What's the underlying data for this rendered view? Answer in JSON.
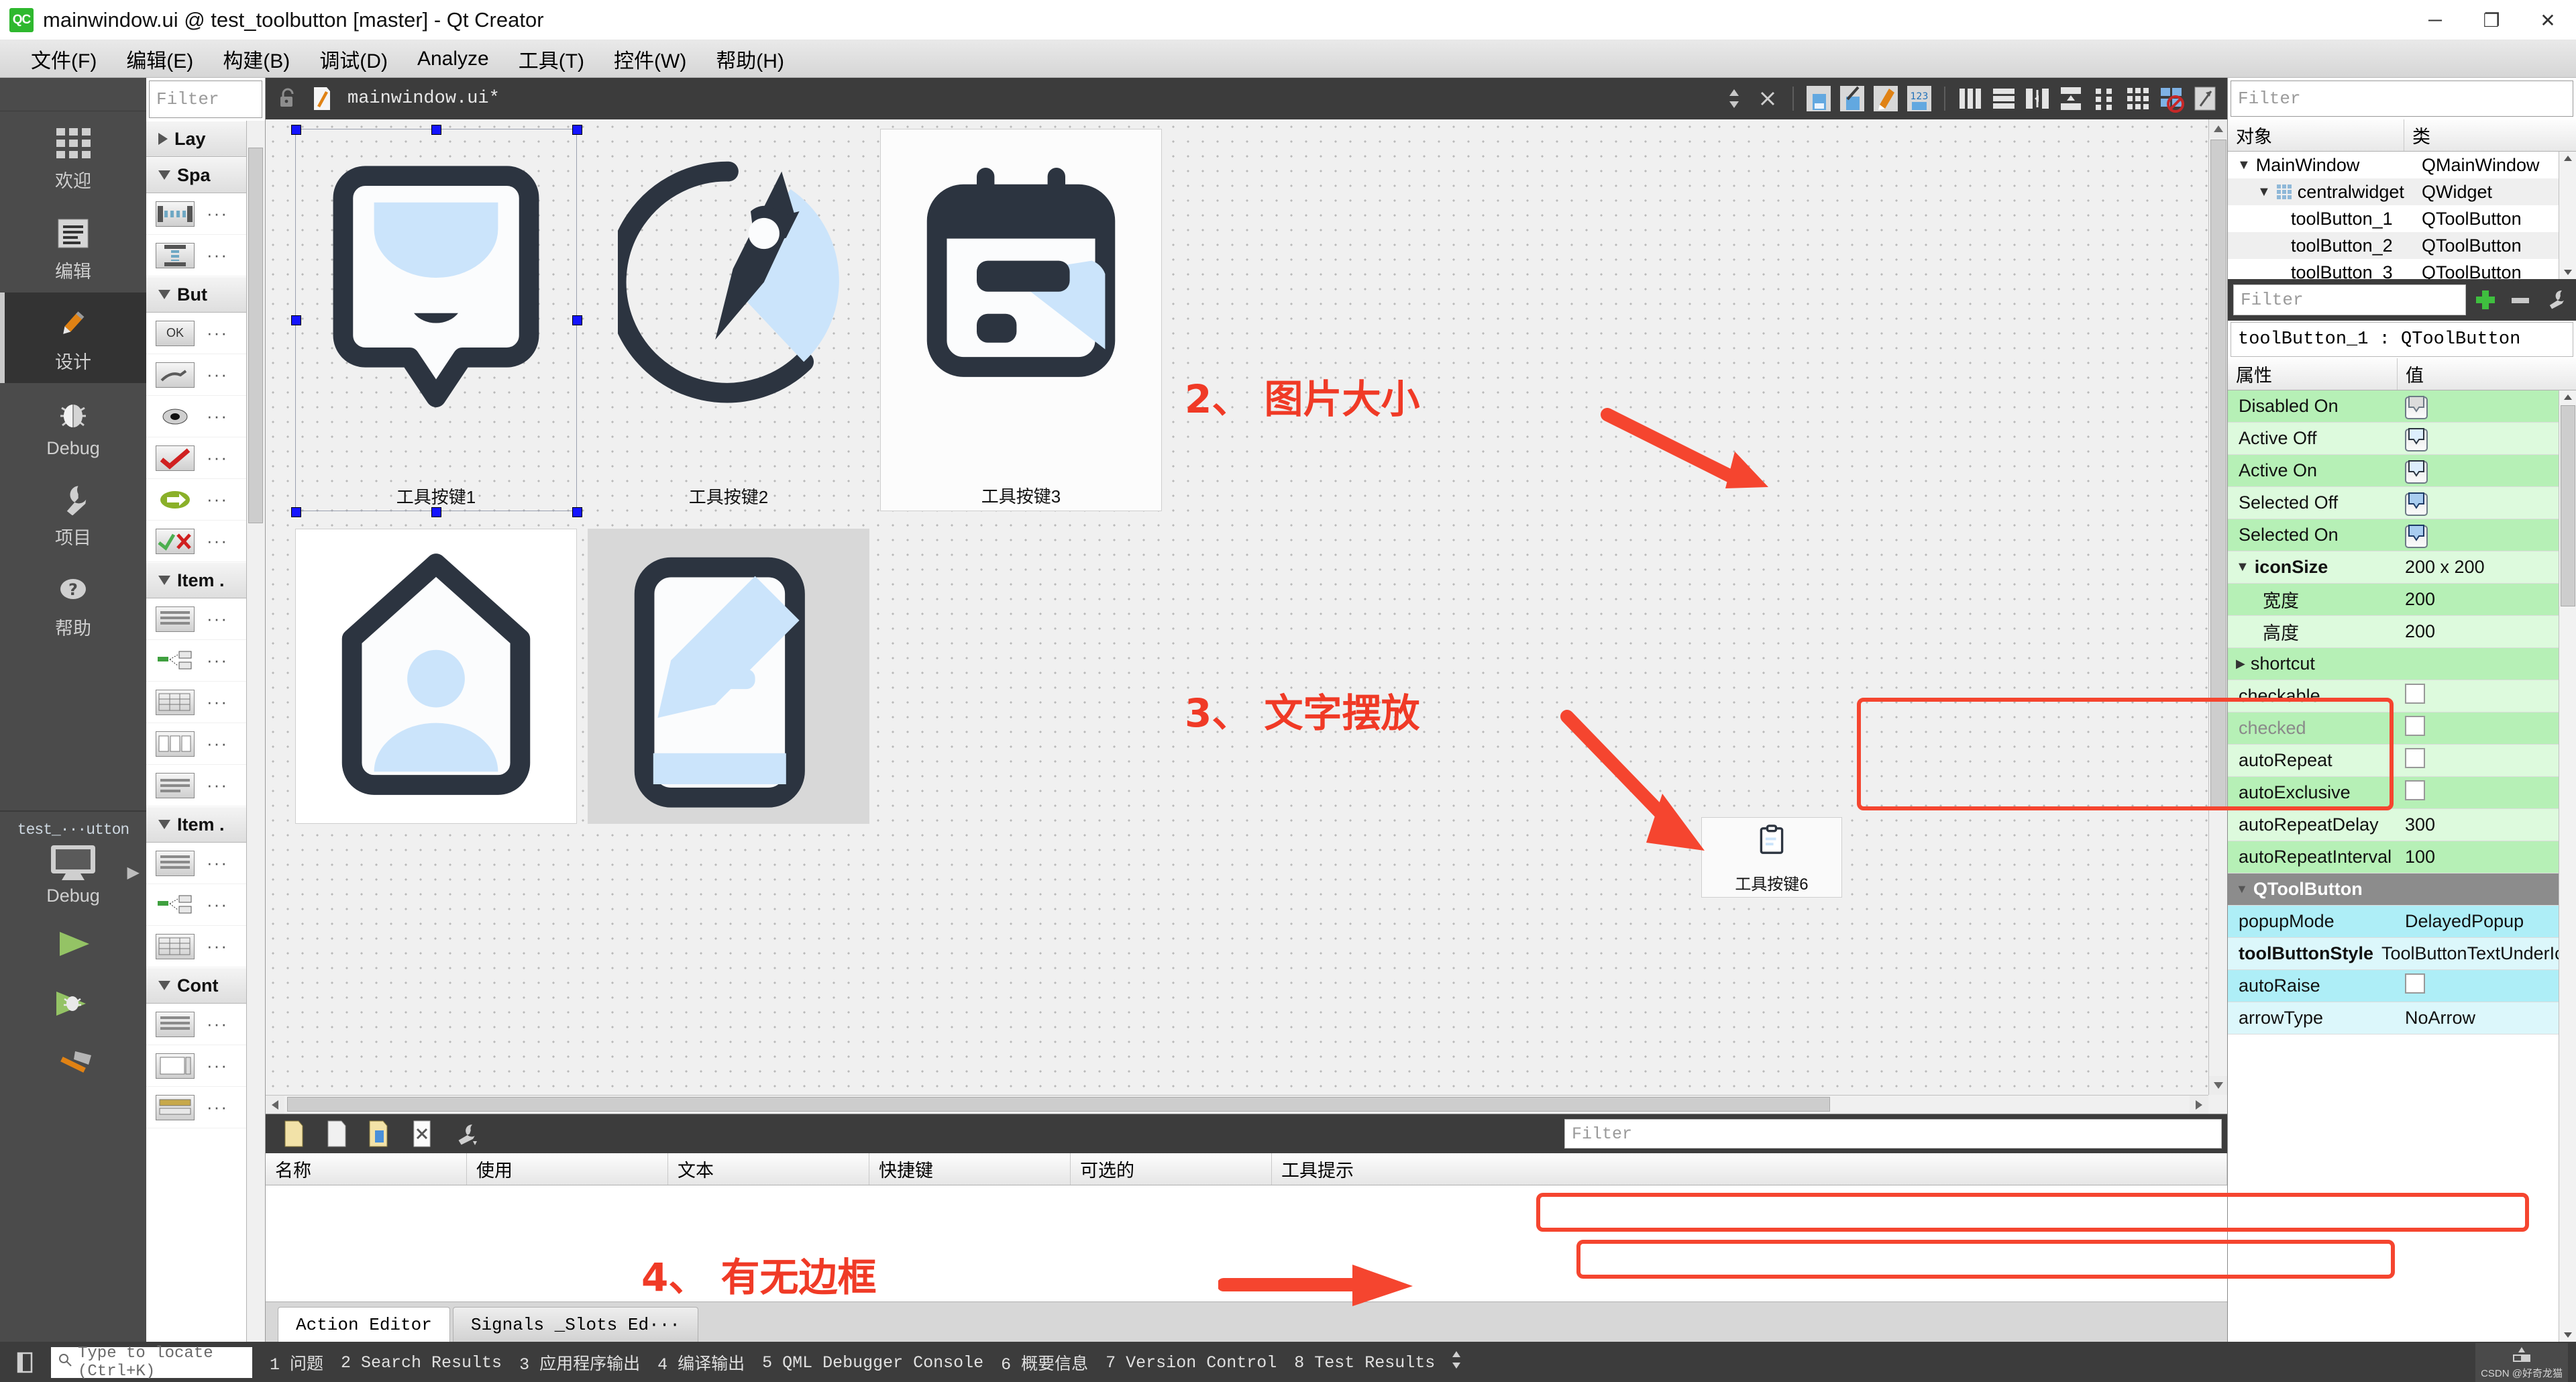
{
  "window": {
    "logo": "QC",
    "title": "mainwindow.ui @ test_toolbutton [master] - Qt Creator",
    "minimize": "─",
    "maximize": "❐",
    "close": "✕"
  },
  "menubar": {
    "items": [
      {
        "label": "文件(F)",
        "key": "F"
      },
      {
        "label": "编辑(E)",
        "key": "E"
      },
      {
        "label": "构建(B)",
        "key": "B"
      },
      {
        "label": "调试(D)",
        "key": "D"
      },
      {
        "label": "Analyze",
        "key": "A"
      },
      {
        "label": "工具(T)",
        "key": "T"
      },
      {
        "label": "控件(W)",
        "key": "W"
      },
      {
        "label": "帮助(H)",
        "key": "H"
      }
    ]
  },
  "modebar": {
    "items": [
      {
        "label": "欢迎",
        "icon": "grid-icon",
        "active": false
      },
      {
        "label": "编辑",
        "icon": "document-icon",
        "active": false
      },
      {
        "label": "设计",
        "icon": "pencil-icon",
        "active": true
      },
      {
        "label": "Debug",
        "icon": "bug-icon",
        "active": false
      },
      {
        "label": "项目",
        "icon": "wrench-icon",
        "active": false
      },
      {
        "label": "帮助",
        "icon": "question-icon",
        "active": false
      }
    ],
    "kit": {
      "project": "test_···utton",
      "config": "Debug",
      "icon": "monitor-icon",
      "arrow": "▶"
    },
    "run_buttons": [
      {
        "name": "run-button",
        "icon": "green-play-icon"
      },
      {
        "name": "debug-button",
        "icon": "green-play-bug-icon"
      },
      {
        "name": "build-button",
        "icon": "hammer-icon"
      }
    ]
  },
  "widgetbox": {
    "filter_placeholder": "Filter",
    "categories": [
      {
        "label": "Lay",
        "expanded": false,
        "items": []
      },
      {
        "label": "Spa",
        "expanded": true,
        "items": [
          {
            "icon": "horizontal-spacer-icon",
            "label": "···"
          },
          {
            "icon": "vertical-spacer-icon",
            "label": "···"
          }
        ]
      },
      {
        "label": "But",
        "expanded": true,
        "items": [
          {
            "icon": "pushbutton-icon",
            "label": "···"
          },
          {
            "icon": "toolbutton-icon",
            "label": "···"
          },
          {
            "icon": "radiobutton-icon",
            "label": "···"
          },
          {
            "icon": "checkbox-icon",
            "label": "···"
          },
          {
            "icon": "commandlinkbutton-icon",
            "label": "···"
          },
          {
            "icon": "dialogbuttonbox-icon",
            "label": "···"
          }
        ]
      },
      {
        "label": "Item .",
        "expanded": true,
        "items": [
          {
            "icon": "listview-icon",
            "label": "···"
          },
          {
            "icon": "treeview-icon",
            "label": "···"
          },
          {
            "icon": "tableview-icon",
            "label": "···"
          },
          {
            "icon": "columnview-icon",
            "label": "···"
          },
          {
            "icon": "undoview-icon",
            "label": "···"
          }
        ]
      },
      {
        "label": "Item .",
        "expanded": true,
        "items": [
          {
            "icon": "listwidget-icon",
            "label": "···"
          },
          {
            "icon": "treewidget-icon",
            "label": "···"
          },
          {
            "icon": "tablewidget-icon",
            "label": "···"
          }
        ]
      },
      {
        "label": "Cont",
        "expanded": true,
        "items": [
          {
            "icon": "groupbox-icon",
            "label": "···"
          },
          {
            "icon": "scrollarea-icon",
            "label": "···"
          },
          {
            "icon": "toolbox-icon",
            "label": "···"
          }
        ]
      }
    ]
  },
  "editor": {
    "filename": "mainwindow.ui*",
    "lock_icon": "unlock-icon",
    "file_icon": "ui-file-icon",
    "nav_updown": "↕",
    "close_icon": "✕",
    "toolbar_icons": [
      "edit-widgets-icon",
      "edit-signals-slots-icon",
      "edit-buddies-icon",
      "edit-tab-order-icon",
      "layout-horizontally-icon",
      "layout-vertically-icon",
      "layout-splitter-h-icon",
      "layout-splitter-v-icon",
      "layout-form-icon",
      "layout-grid-icon",
      "break-layout-icon",
      "adjust-size-icon"
    ]
  },
  "canvas": {
    "buttons": [
      {
        "name": "toolButton_1",
        "label": "工具按键1",
        "icon": "chat-bubble-icon",
        "selected": true
      },
      {
        "name": "toolButton_2",
        "label": "工具按键2",
        "icon": "pie-pen-icon",
        "selected": false
      },
      {
        "name": "toolButton_3",
        "label": "工具按键3",
        "icon": "calendar-note-icon",
        "selected": false
      },
      {
        "name": "toolButton_4",
        "label": "",
        "icon": "home-user-icon",
        "selected": false
      },
      {
        "name": "toolButton_5",
        "label": "",
        "icon": "note-edit-icon",
        "selected": false
      },
      {
        "name": "toolButton_6",
        "label": "工具按键6",
        "icon": "clipboard-icon",
        "selected": false
      }
    ]
  },
  "annotations": [
    {
      "id": "anno-2",
      "text": "2、 图片大小"
    },
    {
      "id": "anno-3",
      "text": "3、 文字摆放"
    },
    {
      "id": "anno-4",
      "text": "4、 有无边框"
    }
  ],
  "objecttree": {
    "filter_placeholder": "Filter",
    "columns": [
      "对象",
      "类"
    ],
    "rows": [
      {
        "indent": 0,
        "expander": "▼",
        "icon": "",
        "object": "MainWindow",
        "class": "QMainWindow"
      },
      {
        "indent": 1,
        "expander": "▼",
        "icon": "grid-icon",
        "object": "centralwidget",
        "class": "QWidget"
      },
      {
        "indent": 2,
        "expander": "",
        "icon": "",
        "object": "toolButton_1",
        "class": "QToolButton"
      },
      {
        "indent": 2,
        "expander": "",
        "icon": "",
        "object": "toolButton_2",
        "class": "QToolButton"
      },
      {
        "indent": 2,
        "expander": "",
        "icon": "",
        "object": "toolButton_3",
        "class": "QToolButton"
      }
    ]
  },
  "propertyeditor": {
    "filter_placeholder": "Filter",
    "add_icon": "plus-icon",
    "remove_icon": "minus-icon",
    "configure_icon": "wrench-icon",
    "object_line": "toolButton_1 : QToolButton",
    "columns": [
      "属性",
      "值"
    ],
    "rows": [
      {
        "name": "Disabled On",
        "value": "",
        "kind": "icon",
        "zebra": "g1",
        "indent": 1
      },
      {
        "name": "Active Off",
        "value": "",
        "kind": "icon",
        "zebra": "g2",
        "indent": 1
      },
      {
        "name": "Active On",
        "value": "",
        "kind": "icon",
        "zebra": "g1",
        "indent": 1
      },
      {
        "name": "Selected Off",
        "value": "",
        "kind": "icon",
        "zebra": "g2",
        "indent": 1
      },
      {
        "name": "Selected On",
        "value": "",
        "kind": "icon",
        "zebra": "g1",
        "indent": 1
      },
      {
        "name": "iconSize",
        "value": "200 x 200",
        "kind": "text",
        "zebra": "g2",
        "indent": 0,
        "expander": "▼",
        "bold": true
      },
      {
        "name": "宽度",
        "value": "200",
        "kind": "text",
        "zebra": "g1",
        "indent": 1
      },
      {
        "name": "高度",
        "value": "200",
        "kind": "text",
        "zebra": "g2",
        "indent": 1
      },
      {
        "name": "shortcut",
        "value": "",
        "kind": "text",
        "zebra": "g1",
        "indent": 0,
        "expander": "▶"
      },
      {
        "name": "checkable",
        "value": "",
        "kind": "check",
        "zebra": "g2",
        "indent": 0
      },
      {
        "name": "checked",
        "value": "",
        "kind": "check",
        "zebra": "g1",
        "indent": 0,
        "disabled": true
      },
      {
        "name": "autoRepeat",
        "value": "",
        "kind": "check",
        "zebra": "g2",
        "indent": 0
      },
      {
        "name": "autoExclusive",
        "value": "",
        "kind": "check",
        "zebra": "g1",
        "indent": 0
      },
      {
        "name": "autoRepeatDelay",
        "value": "300",
        "kind": "text",
        "zebra": "g2",
        "indent": 0
      },
      {
        "name": "autoRepeatInterval",
        "value": "100",
        "kind": "text",
        "zebra": "g1",
        "indent": 0
      },
      {
        "name": "QToolButton",
        "value": "",
        "kind": "group",
        "zebra": "grp",
        "indent": 0,
        "expander": "▼"
      },
      {
        "name": "popupMode",
        "value": "DelayedPopup",
        "kind": "text",
        "zebra": "c1",
        "indent": 0
      },
      {
        "name": "toolButtonStyle",
        "value": "ToolButtonTextUnderIc…",
        "kind": "text",
        "zebra": "c2",
        "indent": 0,
        "bold": true
      },
      {
        "name": "autoRaise",
        "value": "",
        "kind": "check",
        "zebra": "c1",
        "indent": 0
      },
      {
        "name": "arrowType",
        "value": "NoArrow",
        "kind": "text",
        "zebra": "c2",
        "indent": 0
      }
    ]
  },
  "actioneditor": {
    "toolbar_icons": [
      "new-action-icon",
      "copy-icon",
      "paste-icon",
      "delete-icon",
      "configure-icon"
    ],
    "filter_placeholder": "Filter",
    "columns": [
      "名称",
      "使用",
      "文本",
      "快捷键",
      "可选的",
      "工具提示"
    ],
    "rows": [],
    "tabs": [
      {
        "label": "Action Editor",
        "active": true
      },
      {
        "label": "Signals _Slots Ed···",
        "active": false
      }
    ]
  },
  "statusbar": {
    "sidebar_toggle_icon": "sidebar-icon",
    "locator_icon": "search-icon",
    "locator_placeholder": "Type to locate (Ctrl+K)",
    "items": [
      "1 问题",
      "2 Search Results",
      "3 应用程序输出",
      "4 编译输出",
      "5 QML Debugger Console",
      "6 概要信息",
      "7 Version Control",
      "8 Test Results"
    ],
    "updown": "↕",
    "watermark": "CSDN @好奇龙猫"
  },
  "colors": {
    "accent_red": "#f5452f",
    "green_row": "#b6f0b6",
    "cyan_row": "#aeeef7",
    "icon_dark": "#2c3440",
    "icon_light": "#cbe4fb",
    "mode_bg": "#4b4b4b",
    "toolbar_bg": "#3c3c3c"
  }
}
